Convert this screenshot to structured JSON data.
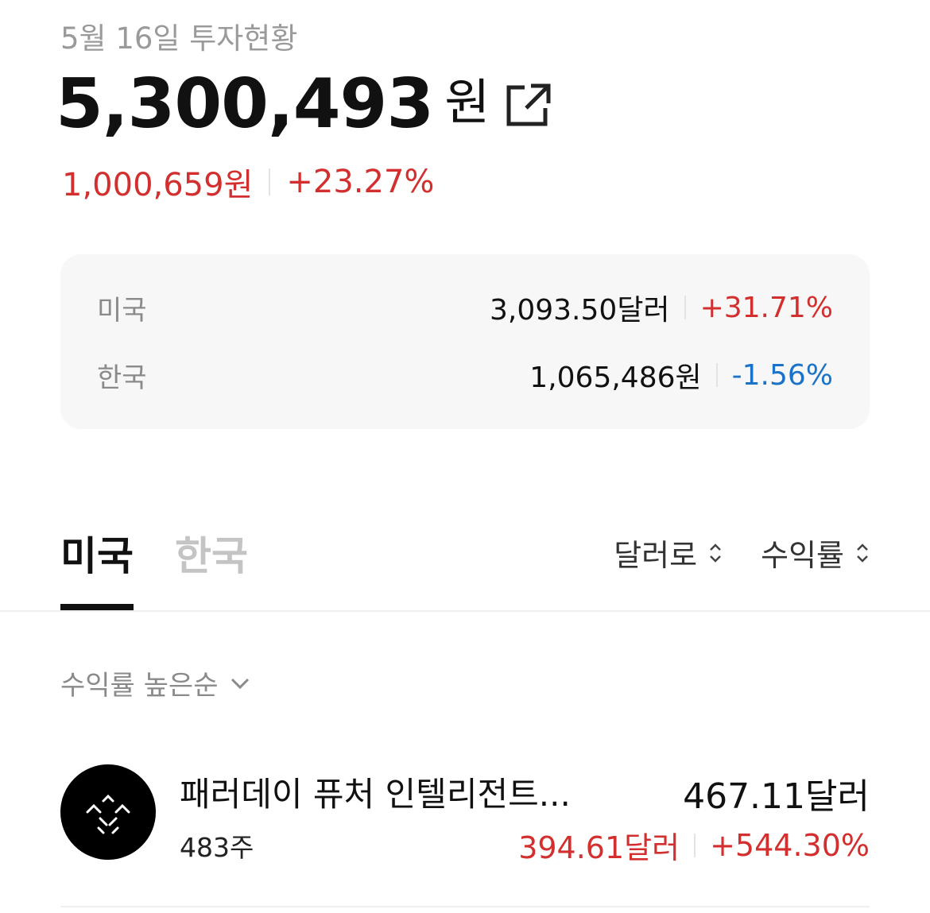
{
  "header": {
    "date_title": "5월 16일 투자현황",
    "total_value": "5,300,493",
    "total_unit": "원",
    "share_icon": "external-link-icon",
    "profit_amount": "1,000,659원",
    "profit_rate": "+23.27%"
  },
  "summary": {
    "rows": [
      {
        "label": "미국",
        "amount": "3,093.50달러",
        "rate": "+31.71%",
        "direction": "up"
      },
      {
        "label": "한국",
        "amount": "1,065,486원",
        "rate": "-1.56%",
        "direction": "down"
      }
    ]
  },
  "tabs": [
    {
      "label": "미국",
      "active": true
    },
    {
      "label": "한국",
      "active": false
    }
  ],
  "controls": {
    "currency_label": "달러로",
    "metric_label": "수익률",
    "sort_icon": "sort-updown-icon"
  },
  "sort": {
    "label": "수익률 높은순",
    "icon": "chevron-down-icon"
  },
  "holdings": [
    {
      "name": "패러데이 퓨처 인텔리전트...",
      "shares": "483주",
      "value": "467.11달러",
      "profit": "394.61달러",
      "rate": "+544.30%",
      "logo_icon": "faraday-future-logo"
    }
  ],
  "colors": {
    "positive": "#d32f2f",
    "negative": "#1a73c8",
    "card_bg": "#f7f7f8",
    "muted_text": "#9a9a9a"
  }
}
